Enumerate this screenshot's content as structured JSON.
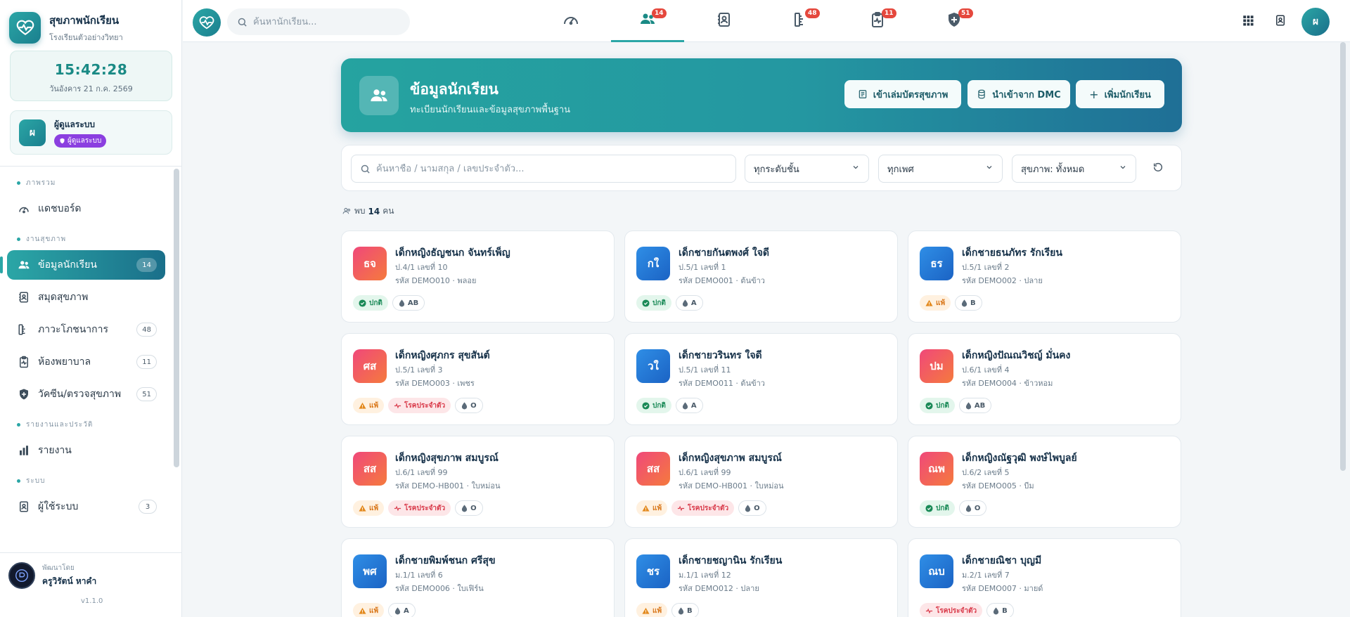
{
  "brand": {
    "title": "สุขภาพนักเรียน",
    "subtitle": "โรงเรียนตัวอย่างวิทยา"
  },
  "clock": {
    "time": "15:42:28",
    "date": "วันอังคาร 21 ก.ค. 2569"
  },
  "user": {
    "initial": "ผ",
    "name": "ผู้ดูแลระบบ",
    "role": "ผู้ดูแลระบบ"
  },
  "nav": {
    "sections": [
      {
        "label": "ภาพรวม"
      },
      {
        "label": "งานสุขภาพ"
      },
      {
        "label": "รายงานและประวัติ"
      },
      {
        "label": "ระบบ"
      }
    ],
    "items": [
      {
        "label": "แดชบอร์ด",
        "icon": "dashboard-icon"
      },
      {
        "label": "ข้อมูลนักเรียน",
        "count": "14",
        "icon": "users-icon"
      },
      {
        "label": "สมุดสุขภาพ",
        "icon": "contact-book-icon"
      },
      {
        "label": "ภาวะโภชนาการ",
        "count": "48",
        "icon": "ruler-icon"
      },
      {
        "label": "ห้องพยาบาล",
        "count": "11",
        "icon": "clipboard-pulse-icon"
      },
      {
        "label": "วัคซีน/ตรวจสุขภาพ",
        "count": "51",
        "icon": "shield-plus-icon"
      },
      {
        "label": "รายงาน",
        "icon": "bar-chart-icon"
      },
      {
        "label": "ผู้ใช้ระบบ",
        "count": "3",
        "icon": "user-badge-icon"
      }
    ]
  },
  "developer": {
    "label": "พัฒนาโดย",
    "name": "ครูวิรัตน์ หาคำ",
    "version": "v1.1.0"
  },
  "topbar": {
    "search_placeholder": "ค้นหานักเรียน...",
    "tabs": [
      {
        "icon": "gauge-icon",
        "badge": ""
      },
      {
        "icon": "users-icon",
        "badge": "14"
      },
      {
        "icon": "contact-book-icon",
        "badge": ""
      },
      {
        "icon": "ruler-icon",
        "badge": "48"
      },
      {
        "icon": "clipboard-pulse-icon",
        "badge": "11"
      },
      {
        "icon": "shield-plus-icon",
        "badge": "51"
      }
    ],
    "avatar_initial": "ผ"
  },
  "header": {
    "title": "ข้อมูลนักเรียน",
    "subtitle": "ทะเบียนนักเรียนและข้อมูลสุขภาพพื้นฐาน",
    "buttons": [
      "เข้าเล่มบัตรสุขภาพ",
      "นำเข้าจาก DMC",
      "เพิ่มนักเรียน"
    ]
  },
  "filters": {
    "search_placeholder": "ค้นหาชื่อ / นามสกุล / เลขประจำตัว...",
    "grade": "ทุกระดับชั้น",
    "gender": "ทุกเพศ",
    "health": "สุขภาพ: ทั้งหมด"
  },
  "result": {
    "prefix": "พบ",
    "count": "14",
    "suffix": "คน"
  },
  "students": [
    {
      "initials": "ธจ",
      "gender": "girl",
      "name": "เด็กหญิงธัญชนก จันทร์เพ็ญ",
      "class": "ป.4/1 เลขที่ 10",
      "code": "รหัส DEMO010 · พลอย",
      "tags": [
        {
          "type": "normal",
          "label": "ปกติ"
        },
        {
          "type": "blood",
          "label": "AB"
        }
      ]
    },
    {
      "initials": "กใ",
      "gender": "boy",
      "name": "เด็กชายกันตพงศ์ ใจดี",
      "class": "ป.5/1 เลขที่ 1",
      "code": "รหัส DEMO001 · ต้นข้าว",
      "tags": [
        {
          "type": "normal",
          "label": "ปกติ"
        },
        {
          "type": "blood",
          "label": "A"
        }
      ]
    },
    {
      "initials": "ธร",
      "gender": "boy",
      "name": "เด็กชายธนภัทร รักเรียน",
      "class": "ป.5/1 เลขที่ 2",
      "code": "รหัส DEMO002 · ปลาย",
      "tags": [
        {
          "type": "allergy",
          "label": "แพ้"
        },
        {
          "type": "blood",
          "label": "B"
        }
      ]
    },
    {
      "initials": "ศส",
      "gender": "girl",
      "name": "เด็กหญิงศุภกร สุขสันต์",
      "class": "ป.5/1 เลขที่ 3",
      "code": "รหัส DEMO003 · เพชร",
      "tags": [
        {
          "type": "allergy",
          "label": "แพ้"
        },
        {
          "type": "disease",
          "label": "โรคประจำตัว"
        },
        {
          "type": "blood",
          "label": "O"
        }
      ]
    },
    {
      "initials": "วใ",
      "gender": "boy",
      "name": "เด็กชายวรินทร ใจดี",
      "class": "ป.5/1 เลขที่ 11",
      "code": "รหัส DEMO011 · ต้นข้าว",
      "tags": [
        {
          "type": "normal",
          "label": "ปกติ"
        },
        {
          "type": "blood",
          "label": "A"
        }
      ]
    },
    {
      "initials": "ปม",
      "gender": "girl",
      "name": "เด็กหญิงปัณณวิชญ์ มั่นคง",
      "class": "ป.6/1 เลขที่ 4",
      "code": "รหัส DEMO004 · ข้าวหอม",
      "tags": [
        {
          "type": "normal",
          "label": "ปกติ"
        },
        {
          "type": "blood",
          "label": "AB"
        }
      ]
    },
    {
      "initials": "สส",
      "gender": "girl",
      "name": "เด็กหญิงสุขภาพ สมบูรณ์",
      "class": "ป.6/1 เลขที่ 99",
      "code": "รหัส DEMO-HB001 · ใบหม่อน",
      "tags": [
        {
          "type": "allergy",
          "label": "แพ้"
        },
        {
          "type": "disease",
          "label": "โรคประจำตัว"
        },
        {
          "type": "blood",
          "label": "O"
        }
      ]
    },
    {
      "initials": "สส",
      "gender": "girl",
      "name": "เด็กหญิงสุขภาพ สมบูรณ์",
      "class": "ป.6/1 เลขที่ 99",
      "code": "รหัส DEMO-HB001 · ใบหม่อน",
      "tags": [
        {
          "type": "allergy",
          "label": "แพ้"
        },
        {
          "type": "disease",
          "label": "โรคประจำตัว"
        },
        {
          "type": "blood",
          "label": "O"
        }
      ]
    },
    {
      "initials": "ณพ",
      "gender": "girl",
      "name": "เด็กหญิงณัฐวุฒิ พงษ์ไพบูลย์",
      "class": "ป.6/2 เลขที่ 5",
      "code": "รหัส DEMO005 · บีม",
      "tags": [
        {
          "type": "normal",
          "label": "ปกติ"
        },
        {
          "type": "blood",
          "label": "O"
        }
      ]
    },
    {
      "initials": "พศ",
      "gender": "boy",
      "name": "เด็กชายพิมพ์ชนก ศรีสุข",
      "class": "ม.1/1 เลขที่ 6",
      "code": "รหัส DEMO006 · ใบเฟิร์น",
      "tags": [
        {
          "type": "allergy",
          "label": "แพ้"
        },
        {
          "type": "blood",
          "label": "A"
        }
      ]
    },
    {
      "initials": "ชร",
      "gender": "boy",
      "name": "เด็กชายชญานิน รักเรียน",
      "class": "ม.1/1 เลขที่ 12",
      "code": "รหัส DEMO012 · ปลาย",
      "tags": [
        {
          "type": "allergy",
          "label": "แพ้"
        },
        {
          "type": "blood",
          "label": "B"
        }
      ]
    },
    {
      "initials": "ณบ",
      "gender": "boy",
      "name": "เด็กชายณิชา บุญมี",
      "class": "ม.2/1 เลขที่ 7",
      "code": "รหัส DEMO007 · มายด์",
      "tags": [
        {
          "type": "disease",
          "label": "โรคประจำตัว"
        },
        {
          "type": "blood",
          "label": "B"
        }
      ]
    }
  ]
}
